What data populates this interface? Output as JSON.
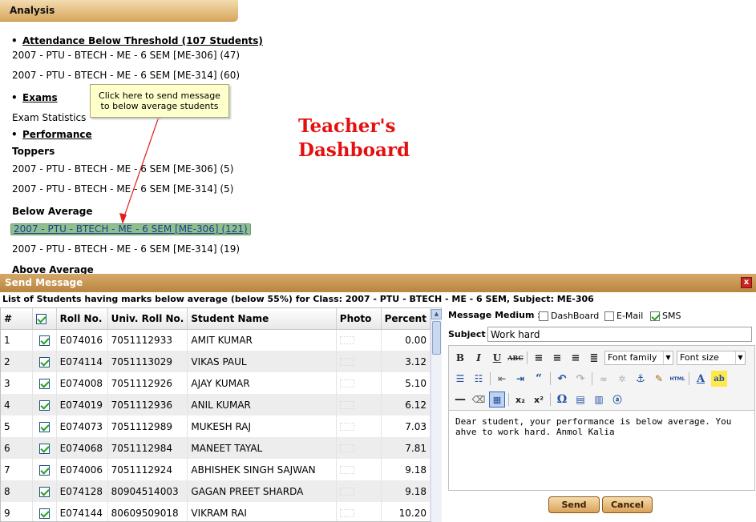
{
  "analysis": {
    "title": "Analysis",
    "attendance_heading": "Attendance Below Threshold (107 Students)",
    "attendance_items": [
      "2007 - PTU - BTECH - ME - 6 SEM [ME-306] (47)",
      "2007 - PTU - BTECH - ME - 6 SEM [ME-314] (60)"
    ],
    "exams_heading": "Exams",
    "exam_statistics": "Exam Statistics",
    "performance_heading": "Performance ",
    "toppers_label": "Toppers",
    "toppers_items": [
      "2007 - PTU - BTECH - ME - 6 SEM [ME-306] (5)",
      "2007 - PTU - BTECH - ME - 6 SEM [ME-314] (5)"
    ],
    "below_label": "Below Average",
    "below_items": [
      "2007 - PTU - BTECH - ME - 6 SEM [ME-306] (121)",
      "2007 - PTU - BTECH - ME - 6 SEM [ME-314] (19)"
    ],
    "above_label": "Above Average"
  },
  "tooltip": "Click here to send message to below average students",
  "dashboard_title_line1": "Teacher's",
  "dashboard_title_line2": "Dashboard",
  "dialog": {
    "title": "Send Message",
    "close_label": "x",
    "caption": "List of Students having marks below average (below 55%) for Class: 2007 - PTU - BTECH - ME - 6 SEM, Subject: ME-306",
    "columns": {
      "num": "#",
      "roll": "Roll No.",
      "univ": "Univ. Roll No.",
      "name": "Student Name",
      "photo": "Photo",
      "percent": "Percent"
    },
    "rows": [
      {
        "num": "1",
        "checked": true,
        "roll": "E074016",
        "univ": "7051112933",
        "name": "AMIT KUMAR",
        "percent": "0.00"
      },
      {
        "num": "2",
        "checked": true,
        "roll": "E074114",
        "univ": "7051113029",
        "name": "VIKAS PAUL",
        "percent": "3.12"
      },
      {
        "num": "3",
        "checked": true,
        "roll": "E074008",
        "univ": "7051112926",
        "name": "AJAY KUMAR",
        "percent": "5.10"
      },
      {
        "num": "4",
        "checked": true,
        "roll": "E074019",
        "univ": "7051112936",
        "name": "ANIL KUMAR",
        "percent": "6.12"
      },
      {
        "num": "5",
        "checked": true,
        "roll": "E074073",
        "univ": "7051112989",
        "name": "MUKESH RAJ",
        "percent": "7.03"
      },
      {
        "num": "6",
        "checked": true,
        "roll": "E074068",
        "univ": "7051112984",
        "name": "MANEET TAYAL",
        "percent": "7.81"
      },
      {
        "num": "7",
        "checked": true,
        "roll": "E074006",
        "univ": "7051112924",
        "name": "ABHISHEK SINGH SAJWAN",
        "percent": "9.18"
      },
      {
        "num": "8",
        "checked": true,
        "roll": "E074128",
        "univ": "80904514003",
        "name": "GAGAN PREET SHARDA",
        "percent": "9.18"
      },
      {
        "num": "9",
        "checked": true,
        "roll": "E074144",
        "univ": "80609509018",
        "name": "VIKRAM RAI",
        "percent": "10.20"
      }
    ],
    "medium_label": "Message Medium :",
    "mediums": [
      {
        "label": "DashBoard",
        "checked": false
      },
      {
        "label": "E-Mail",
        "checked": false
      },
      {
        "label": "SMS",
        "checked": true
      }
    ],
    "subject_label": "Subject :",
    "subject_value": "Work hard",
    "font_family_label": "Font family",
    "font_size_label": "Font size",
    "message_body": "Dear student, your performance is below average. You ahve to work hard. Anmol Kalia",
    "send_label": "Send",
    "cancel_label": "Cancel"
  },
  "colors": {
    "accent": "#d9a75c",
    "title_red": "#e41010",
    "highlight": "#8fbf8f"
  }
}
